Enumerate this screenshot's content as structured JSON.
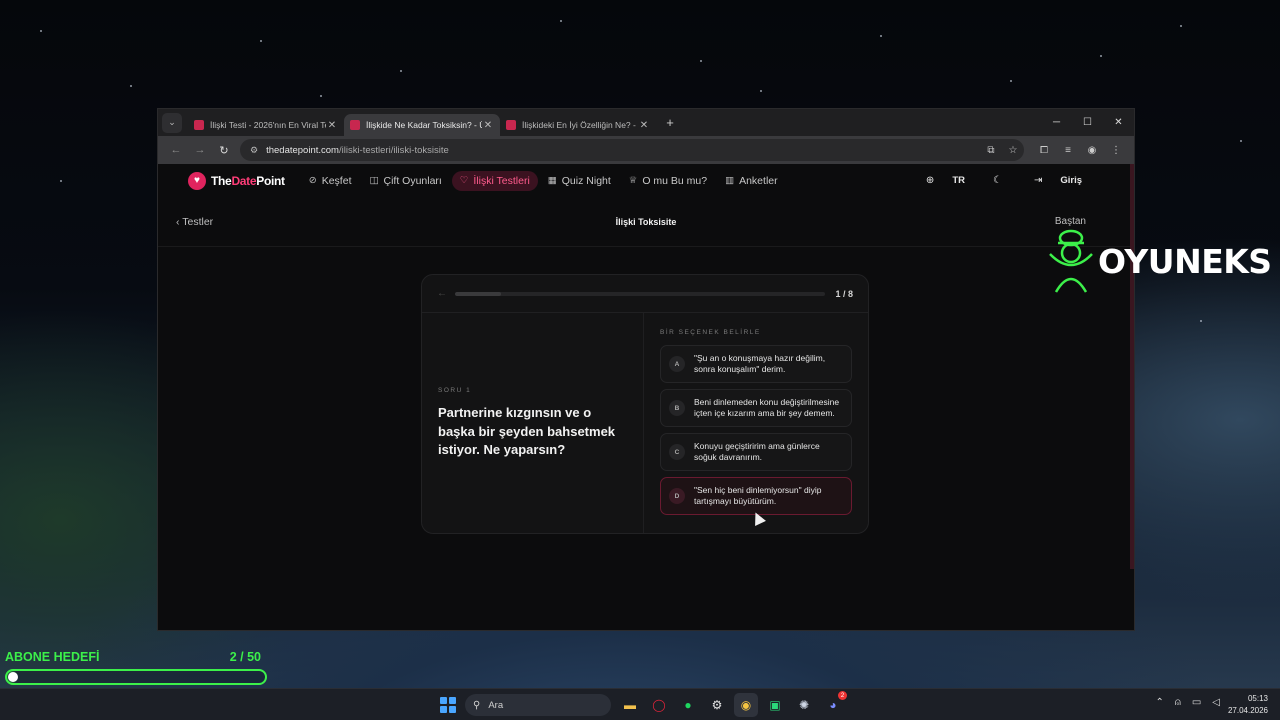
{
  "browser": {
    "tabs": [
      {
        "title": "İlişki Testi - 2026'nın En Viral Te",
        "active": false
      },
      {
        "title": "İlişkide Ne Kadar Toksiksin? - Ü",
        "active": true
      },
      {
        "title": "İlişkideki En İyi Özelliğin Ne? - ",
        "active": false
      }
    ],
    "url_host": "thedatepoint.com",
    "url_path": "/iliski-testleri/iliski-toksisite"
  },
  "site": {
    "logo_the": "The",
    "logo_date": "Date",
    "logo_point": "Point",
    "nav": [
      {
        "label": "Keşfet",
        "icon": "compass-icon",
        "glyph": "⊘"
      },
      {
        "label": "Çift Oyunları",
        "icon": "gamepad-icon",
        "glyph": "◫"
      },
      {
        "label": "İlişki Testleri",
        "icon": "heart-icon",
        "glyph": "♡",
        "active": true
      },
      {
        "label": "Quiz Night",
        "icon": "grid-icon",
        "glyph": "▦"
      },
      {
        "label": "O mu Bu mu?",
        "icon": "trophy-icon",
        "glyph": "♕"
      },
      {
        "label": "Anketler",
        "icon": "bar-chart-icon",
        "glyph": "▥"
      }
    ],
    "language": "TR",
    "login": "Giriş",
    "back_label": "Testler",
    "page_title": "İlişki Toksisite",
    "restart_label": "Baştan"
  },
  "quiz": {
    "counter": "1 / 8",
    "progress": 0.125,
    "question_label": "SORU 1",
    "question": "Partnerine kızgınsın ve o başka bir şeyden bahsetmek istiyor. Ne yaparsın?",
    "answers_label": "BİR SEÇENEK BELİRLE",
    "options": [
      {
        "letter": "A",
        "text": "\"Şu an o konuşmaya hazır değilim, sonra konuşalım\" derim."
      },
      {
        "letter": "B",
        "text": "Beni dinlemeden konu değiştirilmesine içten içe kızarım ama bir şey demem."
      },
      {
        "letter": "C",
        "text": "Konuyu geçiştiririm ama günlerce soğuk davranırım."
      },
      {
        "letter": "D",
        "text": "\"Sen hiç beni dinlemiyorsun\" diyip tartışmayı büyütürüm.",
        "selected": true
      }
    ]
  },
  "overlay": {
    "brand": "OYUNEKS",
    "goal_label": "ABONE HEDEFİ",
    "goal_count": "2 / 50",
    "goal_progress": 0.04
  },
  "taskbar": {
    "search_placeholder": "Ara",
    "time": "05:13",
    "date": "27.04.2026",
    "discord_badge": "2"
  },
  "colors": {
    "accent": "#e0245e",
    "accent_soft": "#ff5c8d",
    "goal_green": "#3cf04a"
  }
}
